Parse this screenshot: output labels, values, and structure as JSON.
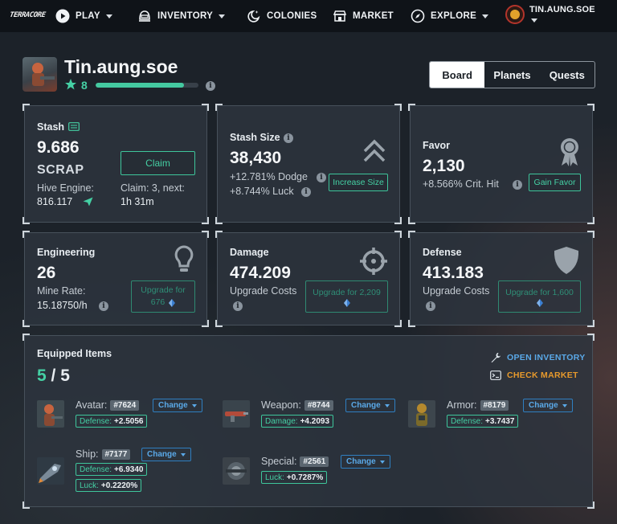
{
  "nav": {
    "logo": "TERRACORE",
    "play": "PLAY",
    "inventory": "INVENTORY",
    "colonies": "COLONIES",
    "market": "MARKET",
    "explore": "EXPLORE",
    "user": "TIN.AUNG.SOE"
  },
  "profile": {
    "username": "Tin.aung.soe",
    "level": "8",
    "xp_progress": 0.86
  },
  "tabs": [
    {
      "label": "Board",
      "active": true
    },
    {
      "label": "Planets",
      "active": false
    },
    {
      "label": "Quests",
      "active": false
    }
  ],
  "stash": {
    "title": "Stash",
    "value": "9.686",
    "unit": "SCRAP",
    "hive_label": "Hive Engine:",
    "hive_value": "816.117",
    "claim_button": "Claim",
    "claim_info_1": "Claim: 3, next:",
    "claim_info_2": "1h 31m"
  },
  "stash_size": {
    "title": "Stash Size",
    "value": "38,430",
    "dodge": "+12.781% Dodge",
    "luck": "+8.744% Luck",
    "button": "Increase Size"
  },
  "favor": {
    "title": "Favor",
    "value": "2,130",
    "crit": "+8.566% Crit. Hit",
    "button": "Gain Favor"
  },
  "engineering": {
    "title": "Engineering",
    "value": "26",
    "mine_label": "Mine Rate:",
    "mine_value": "15.18750/h",
    "button_line1": "Upgrade for",
    "button_line2": "676"
  },
  "damage": {
    "title": "Damage",
    "value": "474.209",
    "costs_label": "Upgrade Costs",
    "button_line1": "Upgrade for 2,209"
  },
  "defense": {
    "title": "Defense",
    "value": "413.183",
    "costs_label": "Upgrade Costs",
    "button_line1": "Upgrade for 1,600"
  },
  "equipped": {
    "title": "Equipped Items",
    "count": "5",
    "slash": " / ",
    "total": "5",
    "open_inventory": "OPEN INVENTORY",
    "check_market": "CHECK MARKET",
    "change_label": "Change",
    "items": {
      "avatar": {
        "label": "Avatar:",
        "id": "#7624",
        "stats": [
          {
            "k": "Defense:",
            "v": "+2.5056"
          }
        ]
      },
      "weapon": {
        "label": "Weapon:",
        "id": "#8744",
        "stats": [
          {
            "k": "Damage:",
            "v": "+4.2093"
          }
        ]
      },
      "armor": {
        "label": "Armor:",
        "id": "#8179",
        "stats": [
          {
            "k": "Defense:",
            "v": "+3.7437"
          }
        ]
      },
      "ship": {
        "label": "Ship:",
        "id": "#7177",
        "stats": [
          {
            "k": "Defense:",
            "v": "+6.9340"
          },
          {
            "k": "Luck:",
            "v": "+0.2220%"
          }
        ]
      },
      "special": {
        "label": "Special:",
        "id": "#2561",
        "stats": [
          {
            "k": "Luck:",
            "v": "+0.7287%"
          }
        ]
      }
    }
  },
  "colors": {
    "accent": "#45d0a4",
    "link_blue": "#5aa9e8",
    "link_orange": "#e89a2c",
    "nav_bg": "#0f1318"
  }
}
